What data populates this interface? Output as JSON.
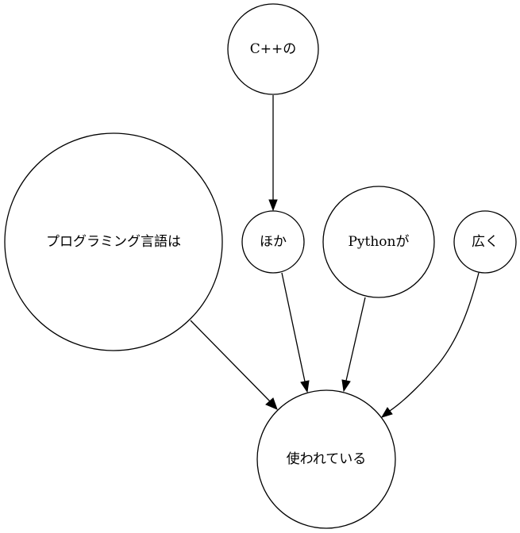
{
  "nodes": {
    "cpp": {
      "label": "C++の"
    },
    "hoka": {
      "label": "ほか"
    },
    "programming": {
      "label": "プログラミング言語は"
    },
    "python": {
      "label": "Pythonが"
    },
    "hiroku": {
      "label": "広く"
    },
    "tsukawarete": {
      "label": "使われている"
    }
  },
  "edges": [
    {
      "from": "cpp",
      "to": "hoka"
    },
    {
      "from": "programming",
      "to": "tsukawarete"
    },
    {
      "from": "hoka",
      "to": "tsukawarete"
    },
    {
      "from": "python",
      "to": "tsukawarete"
    },
    {
      "from": "hiroku",
      "to": "tsukawarete"
    }
  ]
}
